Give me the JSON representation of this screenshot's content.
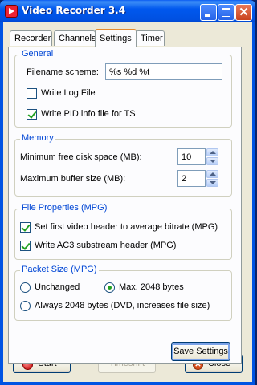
{
  "window": {
    "title": "Video Recorder 3.4"
  },
  "tabs": [
    "Recorder",
    "Channels",
    "Settings",
    "Timer"
  ],
  "active_tab": "Settings",
  "general": {
    "legend": "General",
    "filename_label": "Filename scheme:",
    "filename_value": "%s %d %t",
    "write_log_label": "Write Log File",
    "write_log_checked": false,
    "write_pid_label": "Write PID info file for TS",
    "write_pid_checked": true
  },
  "memory": {
    "legend": "Memory",
    "min_disk_label": "Minimum free disk space (MB):",
    "min_disk_value": "10",
    "max_buffer_label": "Maximum buffer size (MB):",
    "max_buffer_value": "2"
  },
  "file_properties": {
    "legend": "File Properties (MPG)",
    "first_video_label": "Set first video header to average bitrate (MPG)",
    "first_video_checked": true,
    "ac3_label": "Write AC3 substream header (MPG)",
    "ac3_checked": true
  },
  "packet_size": {
    "legend": "Packet Size (MPG)",
    "unchanged_label": "Unchanged",
    "max_label": "Max. 2048 bytes",
    "always_label": "Always 2048 bytes (DVD, increases file size)",
    "selected": "Max. 2048 bytes"
  },
  "buttons": {
    "save_settings": "Save Settings",
    "start": "Start",
    "timeshift": "Timeshift",
    "close": "Close"
  }
}
